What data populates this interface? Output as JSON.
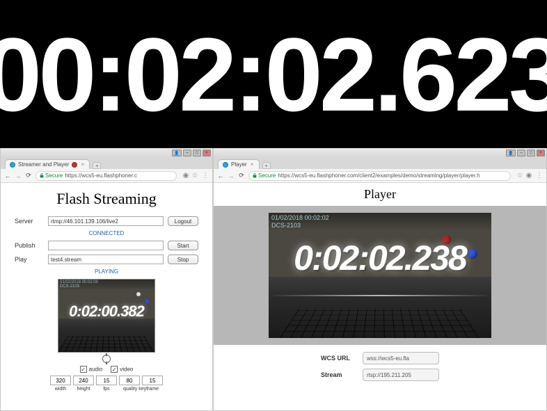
{
  "top_clock": "00:02:02.623",
  "left": {
    "window": {
      "person": "👤",
      "min": "‒",
      "max": "□",
      "close": "×"
    },
    "tab": {
      "title": "Streamer and Player",
      "close": "×"
    },
    "tab_plus": "+",
    "address": {
      "secure_label": "Secure",
      "url": "https://wcs5-eu.flashphoner.c"
    },
    "page": {
      "title": "Flash Streaming",
      "server": {
        "label": "Server",
        "value": "rtmp://46.101.139.106/live2",
        "button": "Logout"
      },
      "connected": "CONNECTED",
      "publish": {
        "label": "Publish",
        "value": "",
        "button": "Start"
      },
      "play": {
        "label": "Play",
        "value": "test4.stream",
        "button": "Stop"
      },
      "playing": "PLAYING",
      "video_top1": "01/02/2018  00:02:00",
      "video_top2": "DCS-2103",
      "video_time": "0:02:00.382",
      "audio_label": "audio",
      "video_label": "video",
      "checked": "✓",
      "params": {
        "width": "320",
        "height": "240",
        "fps": "15",
        "quality": "80",
        "keyframe": "15",
        "lbl_width": "width",
        "lbl_height": "height",
        "lbl_fps": "fps",
        "lbl_qk": "quality keyframe"
      }
    }
  },
  "right": {
    "window": {
      "person": "👤",
      "min": "‒",
      "max": "□",
      "close": "×"
    },
    "tab": {
      "title": "Player",
      "close": "×"
    },
    "tab_plus": "+",
    "address": {
      "secure_label": "Secure",
      "url": "https://wcs5-eu.flashphoner.com/client2/examples/demo/streaming/player/player.h"
    },
    "page": {
      "title": "Player",
      "video_top1": "01/02/2018  00:02:02",
      "video_top2": "DCS-2103",
      "video_time": "0:02:02.238",
      "wcs": {
        "label": "WCS URL",
        "value": "wss://wcs5-eu.fla"
      },
      "stream": {
        "label": "Stream",
        "value": "rtsp://195.211.205"
      }
    }
  },
  "nav": {
    "back": "←",
    "fwd": "→",
    "reload": "⟳",
    "star": "☆",
    "globe": "◉",
    "menu": "⋮"
  }
}
